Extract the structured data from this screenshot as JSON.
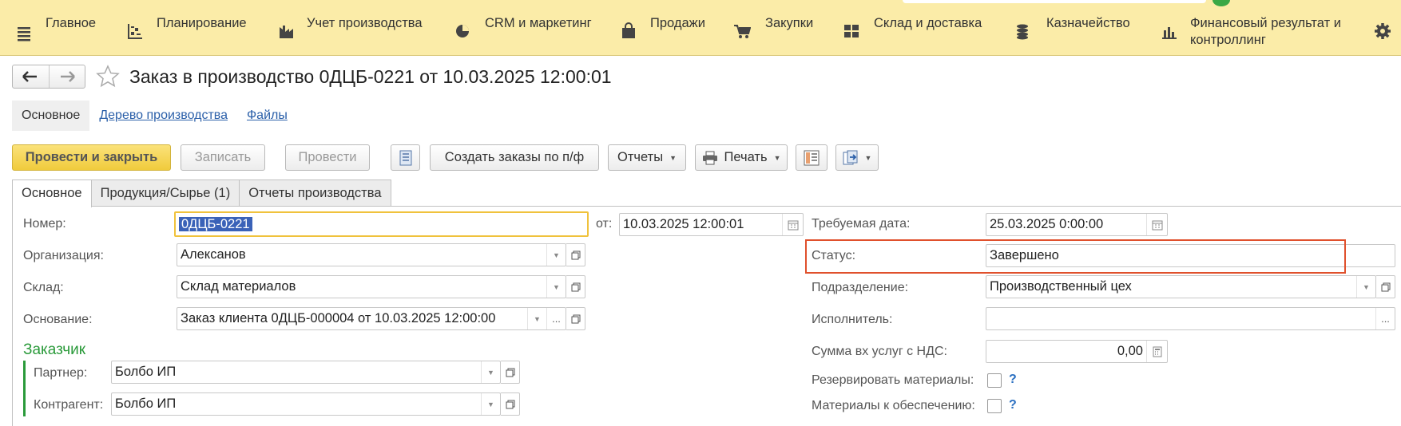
{
  "menu": {
    "items": [
      {
        "label": "Главное",
        "icon": "hamburger-icon"
      },
      {
        "label": "Планирование",
        "icon": "planning-icon"
      },
      {
        "label": "Учет производства",
        "icon": "factory-icon"
      },
      {
        "label": "CRM и маркетинг",
        "icon": "pie-chart-icon"
      },
      {
        "label": "Продажи",
        "icon": "shopping-bag-icon"
      },
      {
        "label": "Закупки",
        "icon": "cart-icon"
      },
      {
        "label": "Склад и доставка",
        "icon": "warehouse-grid-icon"
      },
      {
        "label": "Казначейство",
        "icon": "coins-icon"
      },
      {
        "label": "Финансовый результат и контроллинг",
        "label_line1": "Финансовый результат и",
        "label_line2": "контроллинг",
        "icon": "bar-chart-icon"
      }
    ],
    "settings_icon": "gear-icon"
  },
  "header": {
    "title": "Заказ в производство 0ДЦБ-0221 от 10.03.2025 12:00:01"
  },
  "form_tabs": [
    "Основное",
    "Дерево производства",
    "Файлы"
  ],
  "toolbar": {
    "post_close": "Провести и закрыть",
    "save": "Записать",
    "post": "Провести",
    "create_orders": "Создать заказы по п/ф",
    "reports": "Отчеты",
    "print": "Печать"
  },
  "inner_tabs": [
    "Основное",
    "Продукция/Сырье (1)",
    "Отчеты производства"
  ],
  "fields": {
    "number_label": "Номер:",
    "number_value": "0ДЦБ-0221",
    "from_label": "от:",
    "from_value": "10.03.2025 12:00:01",
    "org_label": "Организация:",
    "org_value": "Алексанов",
    "warehouse_label": "Склад:",
    "warehouse_value": "Склад материалов",
    "basis_label": "Основание:",
    "basis_value": "Заказ клиента 0ДЦБ-000004 от 10.03.2025 12:00:00",
    "required_date_label": "Требуемая дата:",
    "required_date_value": "25.03.2025  0:00:00",
    "status_label": "Статус:",
    "status_value": "Завершено",
    "division_label": "Подразделение:",
    "division_value": "Производственный цех",
    "executor_label": "Исполнитель:",
    "executor_value": "",
    "sum_label": "Сумма вх услуг с НДС:",
    "sum_value": "0,00",
    "reserve_label": "Резервировать материалы:",
    "provide_label": "Материалы к обеспечению:",
    "help_mark": "?"
  },
  "customer": {
    "title": "Заказчик",
    "partner_label": "Партнер:",
    "partner_value": "Болбо ИП",
    "counterparty_label": "Контрагент:",
    "counterparty_value": "Болбо ИП"
  },
  "colors": {
    "menubar": "#fbeca8",
    "primary_button": "#f0cb3c",
    "link": "#2a5fa9",
    "group_title": "#2a9a3a",
    "status_highlight": "#e0502c",
    "selection": "#3a62b8"
  }
}
